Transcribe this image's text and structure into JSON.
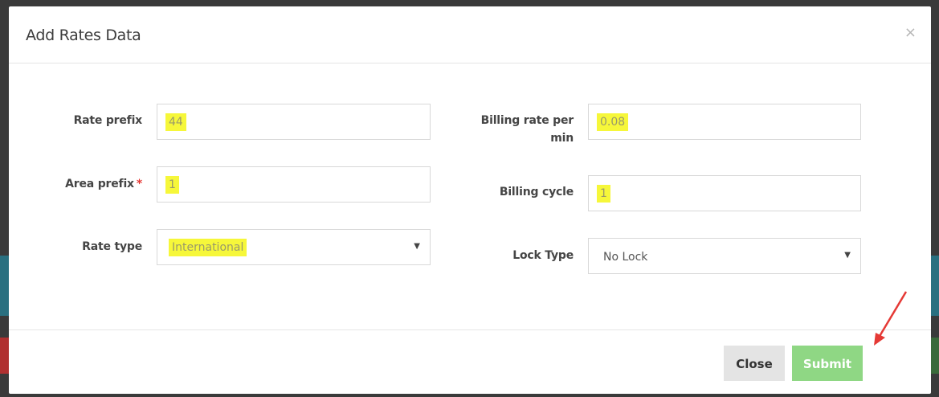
{
  "modal": {
    "title": "Add Rates Data",
    "close_glyph": "×"
  },
  "form": {
    "rate_prefix": {
      "label": "Rate prefix",
      "value": "44"
    },
    "area_prefix": {
      "label": "Area prefix",
      "required_mark": "*",
      "value": "1"
    },
    "rate_type": {
      "label": "Rate type",
      "selected": "International"
    },
    "billing_rate": {
      "label_line1": "Billing rate per",
      "label_line2": "min",
      "value": "0.08"
    },
    "billing_cycle": {
      "label": "Billing cycle",
      "value": "1"
    },
    "lock_type": {
      "label": "Lock Type",
      "selected": "No Lock"
    }
  },
  "footer": {
    "close_label": "Close",
    "submit_label": "Submit"
  },
  "colors": {
    "highlight": "#f6f73a",
    "submit": "#8fd784",
    "annotation_arrow": "#e53935"
  },
  "icons": {
    "select_caret": "caret-down-icon",
    "annotation": "red-arrow-icon"
  }
}
